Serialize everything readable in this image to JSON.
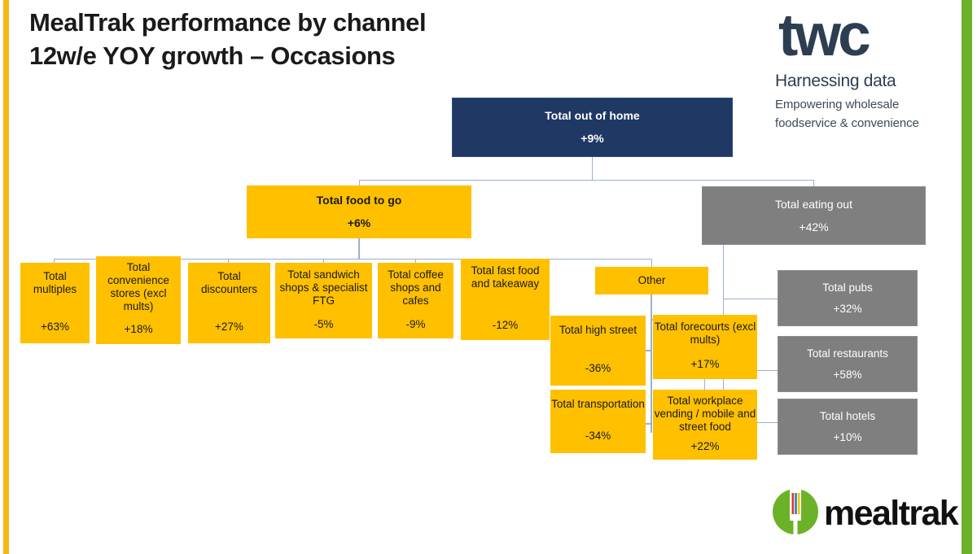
{
  "title": {
    "line1": "MealTrak performance by channel",
    "line2": "12w/e YOY growth – Occasions"
  },
  "brand": {
    "twc_wordmark": "twc",
    "twc_tagline_1": "Harnessing data",
    "twc_tagline_2": "Empowering wholesale foodservice & convenience",
    "mealtrak_wordmark": "mealtrak",
    "navy": "#1F3864",
    "amber": "#FFC000",
    "gray": "#7F7F7F",
    "green": "#6CB229",
    "edge_amber": "#F5B715",
    "connector": "#9DB0CC"
  },
  "chart_data": {
    "type": "diagram",
    "title": "MealTrak performance by channel — 12w/e YOY growth – Occasions",
    "metric": "YOY growth %",
    "nodes": [
      {
        "id": "out_of_home",
        "label": "Total out of home",
        "value": "+9%",
        "value_num": 9,
        "color": "navy",
        "level": 0
      },
      {
        "id": "food_to_go",
        "label": "Total food to go",
        "value": "+6%",
        "value_num": 6,
        "color": "amber",
        "level": 1,
        "parent": "out_of_home"
      },
      {
        "id": "eating_out",
        "label": "Total eating out",
        "value": "+42%",
        "value_num": 42,
        "color": "gray",
        "level": 1,
        "parent": "out_of_home"
      },
      {
        "id": "multiples",
        "label": "Total multiples",
        "value": "+63%",
        "value_num": 63,
        "color": "amber",
        "level": 2,
        "parent": "food_to_go"
      },
      {
        "id": "convenience",
        "label": "Total convenience stores (excl mults)",
        "value": "+18%",
        "value_num": 18,
        "color": "amber",
        "level": 2,
        "parent": "food_to_go"
      },
      {
        "id": "discounters",
        "label": "Total discounters",
        "value": "+27%",
        "value_num": 27,
        "color": "amber",
        "level": 2,
        "parent": "food_to_go"
      },
      {
        "id": "sandwich",
        "label": "Total sandwich shops & specialist FTG",
        "value": "-5%",
        "value_num": -5,
        "color": "amber",
        "level": 2,
        "parent": "food_to_go"
      },
      {
        "id": "coffee",
        "label": "Total coffee shops and cafes",
        "value": "-9%",
        "value_num": -9,
        "color": "amber",
        "level": 2,
        "parent": "food_to_go"
      },
      {
        "id": "fastfood",
        "label": "Total fast food and takeaway",
        "value": "-12%",
        "value_num": -12,
        "color": "amber",
        "level": 2,
        "parent": "food_to_go"
      },
      {
        "id": "other",
        "label": "Other",
        "value": "",
        "value_num": null,
        "color": "amber",
        "level": 2,
        "parent": "food_to_go"
      },
      {
        "id": "high_street",
        "label": "Total high street",
        "value": "-36%",
        "value_num": -36,
        "color": "amber",
        "level": 3,
        "parent": "other"
      },
      {
        "id": "forecourts",
        "label": "Total forecourts (excl mults)",
        "value": "+17%",
        "value_num": 17,
        "color": "amber",
        "level": 3,
        "parent": "other"
      },
      {
        "id": "transportation",
        "label": "Total transportation",
        "value": "-34%",
        "value_num": -34,
        "color": "amber",
        "level": 3,
        "parent": "other"
      },
      {
        "id": "workplace",
        "label": "Total workplace vending / mobile and street food",
        "value": "+22%",
        "value_num": 22,
        "color": "amber",
        "level": 3,
        "parent": "other"
      },
      {
        "id": "pubs",
        "label": "Total pubs",
        "value": "+32%",
        "value_num": 32,
        "color": "gray",
        "level": 2,
        "parent": "eating_out"
      },
      {
        "id": "restaurants",
        "label": "Total restaurants",
        "value": "+58%",
        "value_num": 58,
        "color": "gray",
        "level": 2,
        "parent": "eating_out"
      },
      {
        "id": "hotels",
        "label": "Total hotels",
        "value": "+10%",
        "value_num": 10,
        "color": "gray",
        "level": 2,
        "parent": "eating_out"
      }
    ]
  },
  "nodes": {
    "out_of_home": {
      "label": "Total out of home",
      "value": "+9%"
    },
    "food_to_go": {
      "label": "Total food to go",
      "value": "+6%"
    },
    "eating_out": {
      "label": "Total eating out",
      "value": "+42%"
    },
    "multiples": {
      "label": "Total multiples",
      "value": "+63%"
    },
    "convenience": {
      "label": "Total convenience stores (excl mults)",
      "value": "+18%"
    },
    "discounters": {
      "label": "Total discounters",
      "value": "+27%"
    },
    "sandwich": {
      "label": "Total sandwich shops & specialist FTG",
      "value": "-5%"
    },
    "coffee": {
      "label": "Total coffee shops and cafes",
      "value": "-9%"
    },
    "fastfood": {
      "label": "Total fast food and takeaway",
      "value": "-12%"
    },
    "other": {
      "label": "Other",
      "value": ""
    },
    "high_street": {
      "label": "Total high street",
      "value": "-36%"
    },
    "forecourts": {
      "label": "Total forecourts (excl mults)",
      "value": "+17%"
    },
    "transportation": {
      "label": "Total transportation",
      "value": "-34%"
    },
    "workplace": {
      "label": "Total workplace vending / mobile and street food",
      "value": "+22%"
    },
    "pubs": {
      "label": "Total pubs",
      "value": "+32%"
    },
    "restaurants": {
      "label": "Total restaurants",
      "value": "+58%"
    },
    "hotels": {
      "label": "Total hotels",
      "value": "+10%"
    }
  }
}
